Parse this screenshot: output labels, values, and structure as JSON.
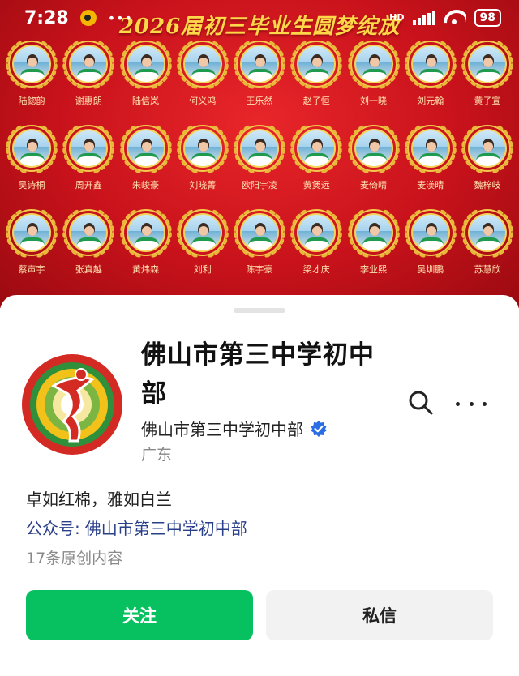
{
  "status_bar": {
    "time": "7:28",
    "dots": "•••",
    "network": "HD",
    "battery": "98"
  },
  "banner": {
    "title": "2026届初三毕业生圆梦绽放",
    "rows": [
      [
        "陆鍃韵",
        "谢惠朗",
        "陆信岚",
        "何义鸿",
        "王乐然",
        "赵子恒",
        "刘一晓",
        "刘元翰",
        "黄子宣"
      ],
      [
        "吴诗桐",
        "周开鑫",
        "朱峻豪",
        "刘晓菁",
        "欧阳宇凌",
        "黄煲远",
        "麦倚晴",
        "麦渼晴",
        "魏梓岐"
      ],
      [
        "蔡声宇",
        "张真越",
        "黄炜森",
        "刘利",
        "陈宇豪",
        "梁才庆",
        "李业熙",
        "吴圳鹏",
        "苏慧欣"
      ]
    ]
  },
  "profile": {
    "name": "佛山市第三中学初中部",
    "subtitle": "佛山市第三中学初中部",
    "region": "广东",
    "slogan": "卓如红棉，雅如白兰",
    "official_label": "公众号:",
    "official_value": "佛山市第三中学初中部",
    "original_count": "17条原创内容"
  },
  "actions": {
    "follow": "关注",
    "message": "私信"
  },
  "icons": {
    "search": "search-icon",
    "more": "more-icon",
    "verified": "verified-badge-icon"
  },
  "colors": {
    "follow_green": "#07c160",
    "banner_red": "#c8121b",
    "verified_blue": "#2b6de5"
  }
}
